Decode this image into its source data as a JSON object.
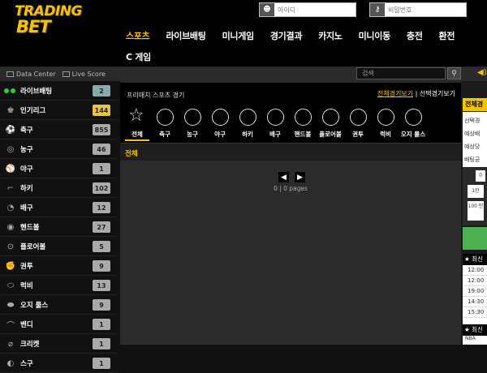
{
  "brand": {
    "line1": "TRADING",
    "line2": "BET"
  },
  "login": {
    "id_placeholder": "아이디",
    "pw_placeholder": "비밀번호"
  },
  "nav": {
    "row1": [
      "스포츠",
      "라이브배팅",
      "미니게임",
      "경기결과",
      "카지노",
      "미니이동",
      "충전",
      "환전"
    ],
    "row2": [
      "C 게임"
    ]
  },
  "subbar": {
    "data_center": "Data Center",
    "live_score": "Live Score",
    "search_placeholder": "검색"
  },
  "sidebar": [
    {
      "label": "라이브배팅",
      "count": "2",
      "icon": "live-dots",
      "badge": "blue"
    },
    {
      "label": "인기리그",
      "count": "144",
      "icon": "trophy",
      "badge": "gold"
    },
    {
      "label": "축구",
      "count": "855",
      "icon": "soccer-ball"
    },
    {
      "label": "농구",
      "count": "46",
      "icon": "basketball"
    },
    {
      "label": "야구",
      "count": "1",
      "icon": "baseball"
    },
    {
      "label": "하키",
      "count": "102",
      "icon": "hockey-stick"
    },
    {
      "label": "배구",
      "count": "12",
      "icon": "volleyball"
    },
    {
      "label": "핸드볼",
      "count": "27",
      "icon": "handball"
    },
    {
      "label": "플로어볼",
      "count": "5",
      "icon": "floorball"
    },
    {
      "label": "권투",
      "count": "9",
      "icon": "boxing-glove"
    },
    {
      "label": "럭비",
      "count": "13",
      "icon": "rugby-ball"
    },
    {
      "label": "오지 룰스",
      "count": "9",
      "icon": "aussie-rules-ball"
    },
    {
      "label": "밴디",
      "count": "1",
      "icon": "bandy"
    },
    {
      "label": "크리켓",
      "count": "1",
      "icon": "cricket"
    },
    {
      "label": "스구",
      "count": "1",
      "icon": "squash"
    }
  ],
  "main": {
    "title": "프리매치 스포츠 경기",
    "link_all": "전체경기보기",
    "separator": "|",
    "link_selected": "선택경기보기",
    "sports": [
      "전체",
      "축구",
      "농구",
      "야구",
      "하키",
      "배구",
      "핸드볼",
      "플로어볼",
      "권투",
      "럭비",
      "오지 룰스"
    ],
    "section": "전체",
    "pagination": "0 | 0 pages"
  },
  "right": {
    "top": "전체경",
    "info": [
      "선택경",
      "예상배",
      "예상당",
      "배팅금"
    ],
    "amount_value": "0",
    "buttons": [
      "1만",
      "100 만"
    ],
    "list_header": "★ 최신",
    "times": [
      "12:00",
      "12:00",
      "19:00",
      "14:30",
      "15:30"
    ],
    "bottom_header": "★ 최신",
    "last_item": "NBA"
  },
  "colors": {
    "accent": "#f5c400",
    "bg": "#111111",
    "panel": "#2b2b2b"
  }
}
